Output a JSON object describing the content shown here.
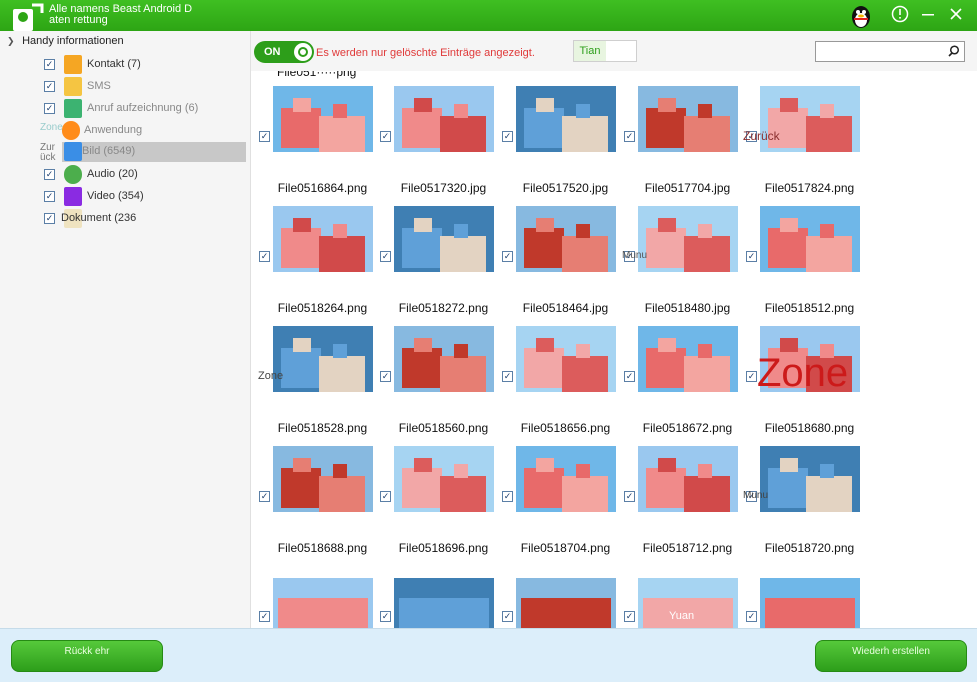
{
  "app": {
    "title": "Alle namens Beast Android D aten rettung",
    "brand_color": "#2da514"
  },
  "sidebar": {
    "root_label": "Handy informationen",
    "items": [
      {
        "label": "Kontakt (7)",
        "icon": "contacts-icon",
        "color": "#f5a623"
      },
      {
        "label": "SMS",
        "icon": "sms-icon",
        "color": "#f5c542"
      },
      {
        "label": "Anruf aufzeichnung (6)",
        "icon": "phone-icon",
        "color": "#3cb371"
      },
      {
        "label": "Anwendung",
        "icon": "app-icon",
        "color": "#ff8c1a"
      },
      {
        "label": "Bild (6549)",
        "icon": "image-icon",
        "color": "#3a8ee6"
      },
      {
        "label": "Audio (20)",
        "icon": "audio-icon",
        "color": "#4cae4c"
      },
      {
        "label": "Video (354)",
        "icon": "video-icon",
        "color": "#8a2be2"
      },
      {
        "label": "Dokument (236",
        "icon": "document-icon",
        "color": "#d9c28a"
      }
    ],
    "ghost_zone": "Zone",
    "ghost_back": "Zur ück"
  },
  "toolbar": {
    "toggle_label": "ON",
    "filter_message": "Es werden nur gelöschte Einträge angezeigt.",
    "view_active": "Tian",
    "search_placeholder": ""
  },
  "grid": {
    "rows": [
      {
        "files": [
          "File0516864.png",
          "File0517320.jpg",
          "File0517520.jpg",
          "File0517704.jpg",
          "File0517824.png"
        ]
      },
      {
        "files": [
          "File0518264.png",
          "File0518272.png",
          "File0518464.jpg",
          "File0518480.jpg",
          "File0518512.png"
        ]
      },
      {
        "files": [
          "File0518528.png",
          "File0518560.png",
          "File0518656.png",
          "File0518672.png",
          "File0518680.png"
        ]
      },
      {
        "files": [
          "File0518688.png",
          "File0518696.png",
          "File0518704.png",
          "File0518712.png",
          "File0518720.png"
        ]
      }
    ],
    "overlay_texts": {
      "zurueck": "Zurück",
      "munu": "Munu",
      "zone_small": "Zone",
      "zone_big": "Zone",
      "yuan": "Yuan"
    }
  },
  "footer": {
    "back_label": "Rückk ehr",
    "restore_label": "Wiederh erstellen"
  }
}
